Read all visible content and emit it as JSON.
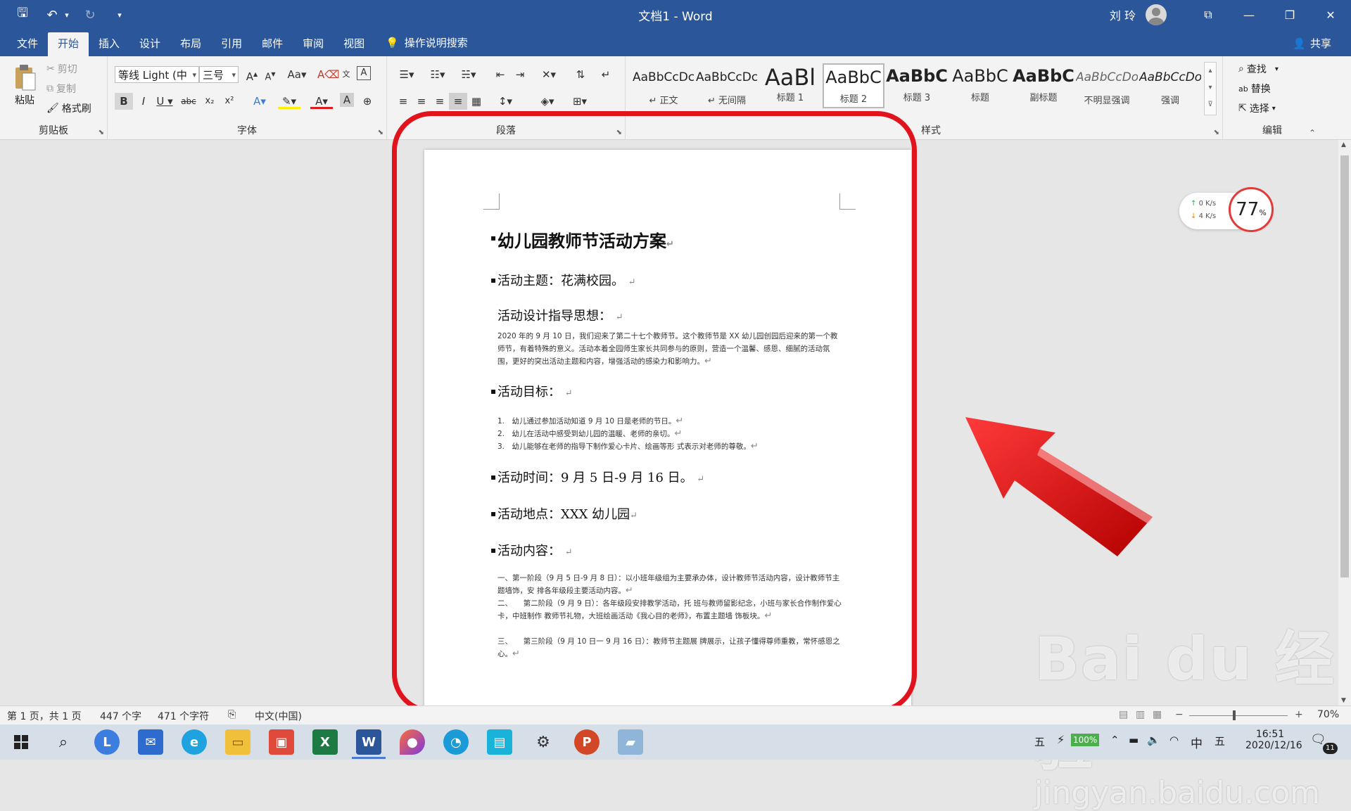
{
  "window": {
    "title": "文档1 - Word",
    "user": "刘 玲",
    "controls": [
      "⧉",
      "—",
      "❐",
      "✕"
    ]
  },
  "qat": {
    "save": "🖫",
    "undo": "↶",
    "undo_drop": "▾",
    "redo": "↻",
    "customize": "▾"
  },
  "tabs": [
    "文件",
    "开始",
    "插入",
    "设计",
    "布局",
    "引用",
    "邮件",
    "审阅",
    "视图"
  ],
  "active_tab": "开始",
  "tell_me": "操作说明搜索",
  "share": "共享",
  "ribbon": {
    "clipboard": {
      "label": "剪贴板",
      "paste": "粘贴",
      "cut": "剪切",
      "copy": "复制",
      "format_painter": "格式刷"
    },
    "font": {
      "label": "字体",
      "font_name": "等线 Light (中",
      "font_size": "三号"
    },
    "paragraph": {
      "label": "段落"
    },
    "styles": {
      "label": "样式",
      "items": [
        {
          "sample": "AaBbCcDc",
          "name": "↵ 正文"
        },
        {
          "sample": "AaBbCcDc",
          "name": "↵ 无间隔"
        },
        {
          "sample": "AaBl",
          "name": "标题 1"
        },
        {
          "sample": "AaBbC",
          "name": "标题 2"
        },
        {
          "sample": "AaBbC",
          "name": "标题 3"
        },
        {
          "sample": "AaBbC",
          "name": "标题"
        },
        {
          "sample": "AaBbC",
          "name": "副标题"
        },
        {
          "sample": "AaBbCcDo",
          "name": "不明显强调"
        },
        {
          "sample": "AaBbCcDo",
          "name": "强调"
        }
      ]
    },
    "editing": {
      "label": "编辑",
      "find": "查找",
      "replace": "替换",
      "select": "选择"
    }
  },
  "document": {
    "title": "幼儿园教师节活动方案",
    "theme": "活动主题：花满校园。",
    "design_heading": "活动设计指导思想：",
    "design_para": "2020 年的 9 月 10 日，我们迎来了第二十七个教师节。这个教师节是 XX 幼儿园创园后迎来的第一个教师节，有着特殊的意义。活动本着全园师生家长共同参与的原则，营造一个温馨、感恩、细腻的活动氛围，更好的突出活动主题和内容，增强活动的感染力和影响力。",
    "goal_heading": "活动目标：",
    "goals": [
      "1.　幼儿通过参加活动知道 9 月 10 日是老师的节日。",
      "2.　幼儿在活动中感受到幼儿园的温暖、老师的亲切。",
      "3.　幼儿能够在老师的指导下制作爱心卡片、绘画等形 式表示对老师的尊敬。"
    ],
    "time": "活动时间：9 月 5 日-9 月 16 日。",
    "place": "活动地点：XXX 幼儿园",
    "content_heading": "活动内容：",
    "content_para1": "一、第一阶段（9 月 5 日-9 月 8 日）：以小班年级组为主要承办体，设计教师节活动内容，设计教师节主题墙饰，安 排各年级段主要活动内容。",
    "content_para2": "二、　　第二阶段（9 月 9 日）：各年级段安排教学活动，托 班与教师留影纪念，小班与家长合作制作爱心卡，中班制作 教师节礼物，大班绘画活动《我心目的老师》，布置主题墙 饰板块。",
    "content_para3": "三、　　第三阶段（9 月 10 日一 9 月 16 日）：教师节主题展 牌展示，让孩子懂得尊师重教，常怀感恩之心。",
    "para_mark": "↵"
  },
  "netspeed": {
    "up": "0 K/s",
    "down": "4 K/s",
    "percent": "77",
    "unit": "%"
  },
  "watermark": {
    "brand": "Bai du 经验",
    "url": "jingyan.baidu.com"
  },
  "status": {
    "page": "第 1 页，共 1 页",
    "words": "447 个字",
    "chars": "471 个字符",
    "language": "中文(中国)",
    "zoom": "70%"
  },
  "taskbar": {
    "battery": "100%",
    "ime1": "五",
    "ime2": "中",
    "ime3": "五",
    "time": "16:51",
    "date": "2020/12/16",
    "notifications": "11"
  },
  "colors": {
    "word_blue": "#2b579a",
    "highlight_red": "#e1131c"
  }
}
